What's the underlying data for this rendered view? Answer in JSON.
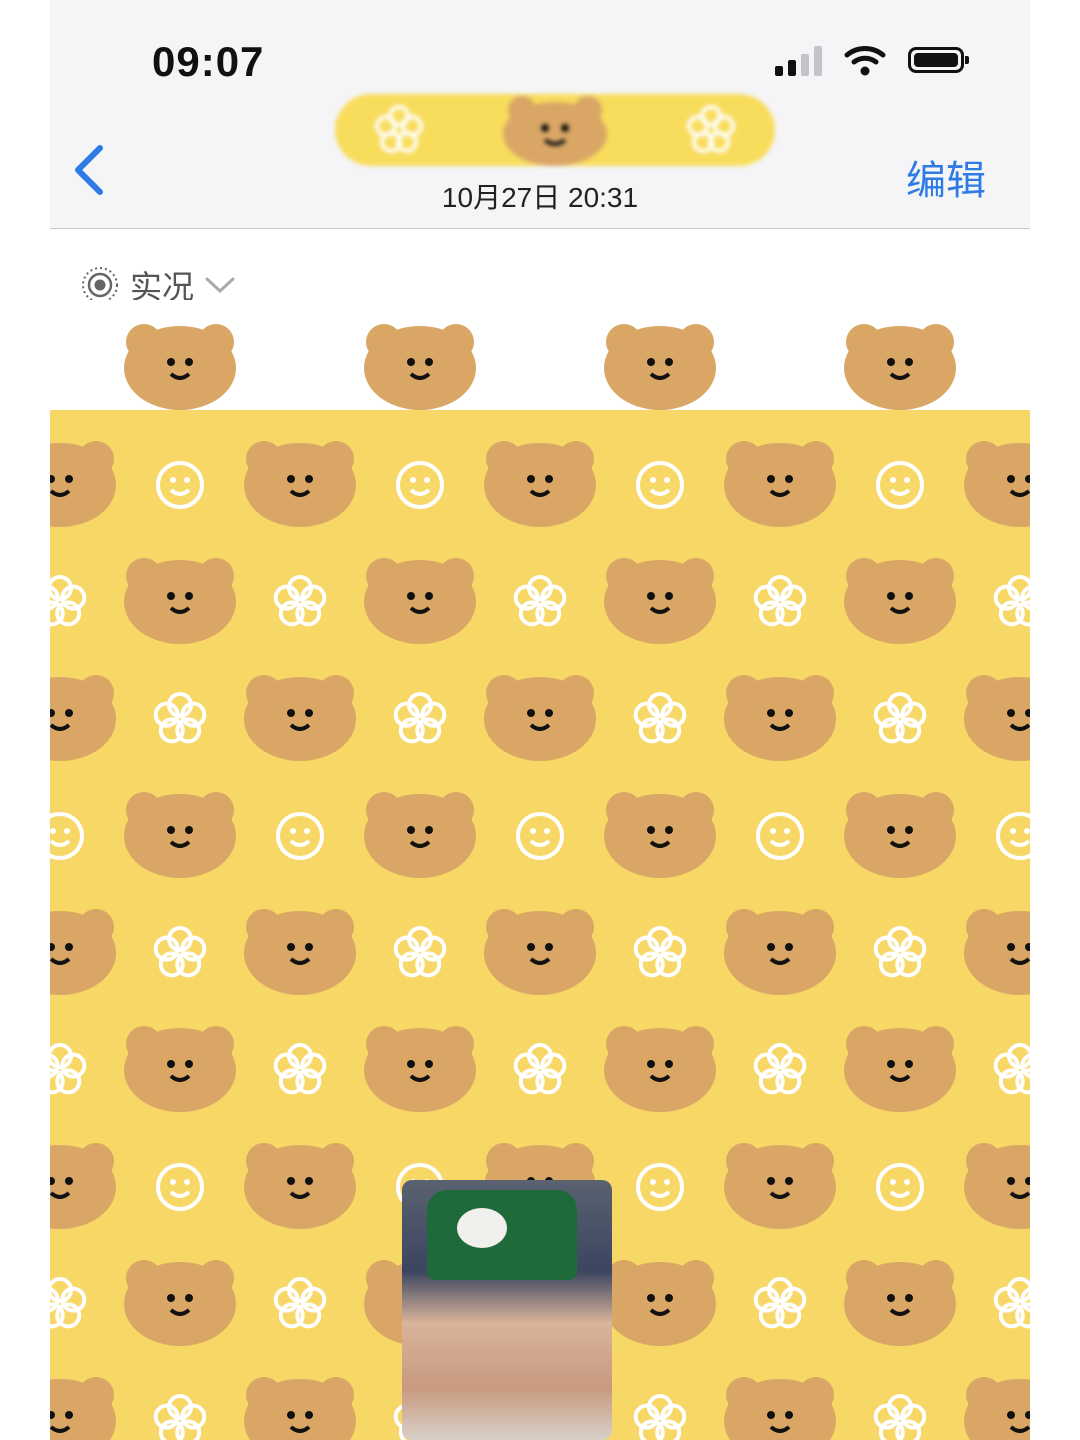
{
  "status_bar": {
    "time": "09:07",
    "icons": [
      "cellular-signal-icon",
      "wifi-icon",
      "battery-icon"
    ]
  },
  "nav": {
    "back_icon": "chevron-left-icon",
    "subtitle": "10月27日  20:31",
    "edit_label": "编辑"
  },
  "live_photo": {
    "icon": "live-photo-icon",
    "label": "实况",
    "dropdown_icon": "chevron-down-icon"
  },
  "colors": {
    "accent": "#2f7be5",
    "sticker_yellow": "#f7d765",
    "bear_brown": "#d9a665"
  }
}
